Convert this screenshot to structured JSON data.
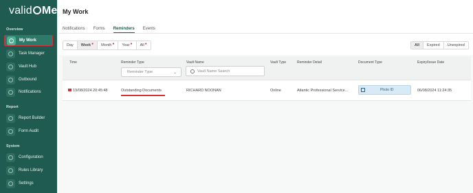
{
  "sidebar": {
    "logo_text": "valid",
    "logo_me": "Me",
    "sections": {
      "overview": "Overview",
      "report": "Report",
      "system": "System"
    },
    "items": [
      {
        "label": "My Work",
        "icon": "check-circle-icon",
        "active": true
      },
      {
        "label": "Task Manager",
        "icon": "task-icon"
      },
      {
        "label": "Vault Hub",
        "icon": "vault-icon"
      },
      {
        "label": "Outbound",
        "icon": "outbound-icon"
      },
      {
        "label": "Notifications",
        "icon": "bell-icon"
      },
      {
        "label": "Report Builder",
        "icon": "report-icon"
      },
      {
        "label": "Form Audit",
        "icon": "audit-icon"
      },
      {
        "label": "Configuration",
        "icon": "gear-icon"
      },
      {
        "label": "Rules Library",
        "icon": "rules-icon"
      },
      {
        "label": "Settings",
        "icon": "settings-icon"
      }
    ]
  },
  "header": {
    "title": "My Work"
  },
  "tabs": [
    "Notifications",
    "Forms",
    "Reminders",
    "Events"
  ],
  "active_tab": "Reminders",
  "period_filter": [
    "Day",
    "Week",
    "Month",
    "Year",
    "All"
  ],
  "status_filter": [
    "All",
    "Expired",
    "Unexpired"
  ],
  "table": {
    "columns": [
      "Time",
      "Reminder Type",
      "Vault Name",
      "Vault Type",
      "Reminder Detail",
      "Document Type",
      "Expiry/Issue Date"
    ],
    "reminder_type_placeholder": "Reminder Type",
    "vault_name_placeholder": "Vault Name Search",
    "rows": [
      {
        "time": "13/08/2024 20:45:48",
        "reminder_type": "Outstanding Documents",
        "vault_name": "RICHARD NOONAN",
        "vault_type": "Online",
        "reminder_detail": "Atlantic Professional Service...",
        "document_type": "Photo ID",
        "expiry_date": "06/08/2024 11:24:35"
      }
    ]
  },
  "colors": {
    "sidebar": "#1f5b50",
    "accent": "#2d7a6a",
    "highlight": "#d62f3a"
  }
}
